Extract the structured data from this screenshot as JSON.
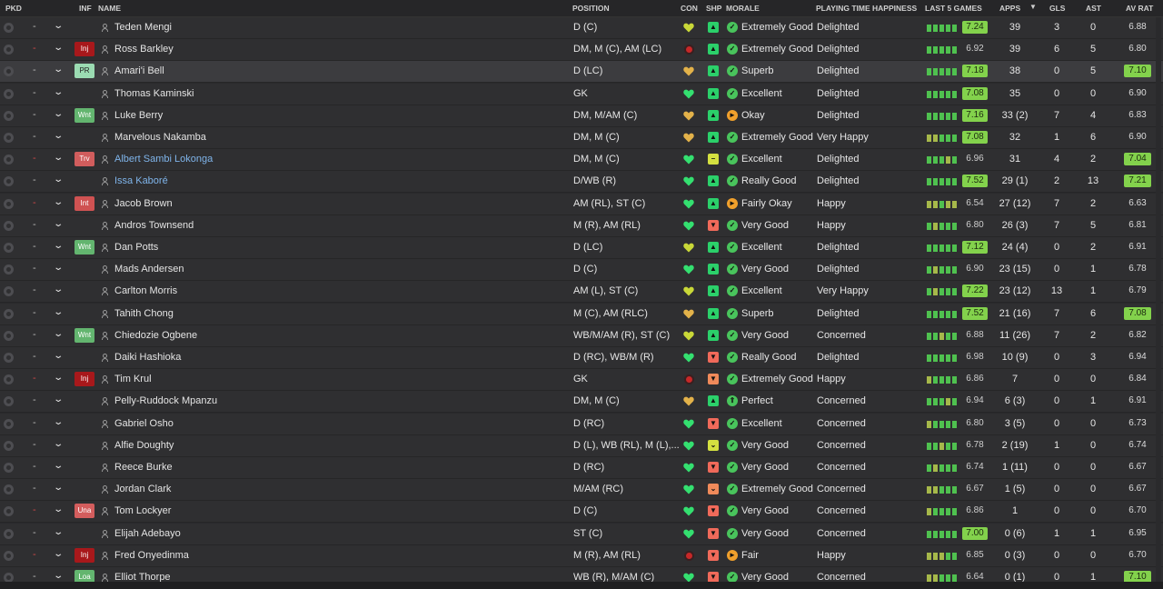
{
  "headers": {
    "pkd": "PKD",
    "inf": "INF",
    "name": "NAME",
    "position": "POSITION",
    "con": "CON",
    "shp": "SHP",
    "morale": "MORALE",
    "playing_time": "PLAYING TIME HAPPINESS",
    "last5": "LAST 5 GAMES",
    "apps": "APPS",
    "sort_icon": "sort-desc-icon",
    "gls": "GLS",
    "ast": "AST",
    "av_rat": "AV RAT"
  },
  "colors": {
    "form_green": "#4fc14f",
    "form_olive": "#a6b84a",
    "form_orange": "#d48a3e",
    "rating_highlight": "#83d24c",
    "injury_red": "#a8181b",
    "link_blue": "#7fb4ea"
  },
  "players": [
    {
      "dash": "-",
      "inf": "",
      "name": "Teden Mengi",
      "position": "D (C)",
      "con": "yellow",
      "shp": "g",
      "shp_icon": "arrow-up-icon",
      "mor": "g",
      "mor_icon": "thumbs-up-icon",
      "morale": "Extremely Good",
      "pt": "Delighted",
      "form": [
        "g",
        "g",
        "g",
        "g",
        "g"
      ],
      "l5": "7.24",
      "l5_hi": true,
      "apps": "39",
      "gls": "3",
      "ast": "0",
      "avr": "6.88",
      "avr_hi": false
    },
    {
      "dash": "-",
      "inf": "Inj",
      "inf_class": "inj",
      "name": "Ross Barkley",
      "position": "DM, M (C), AM (LC)",
      "con": "injured",
      "shp": "g",
      "shp_icon": "arrow-up-icon",
      "mor": "g",
      "mor_icon": "thumbs-up-icon",
      "morale": "Extremely Good",
      "pt": "Delighted",
      "form": [
        "g",
        "g",
        "g",
        "g",
        "g"
      ],
      "l5": "6.92",
      "l5_hi": false,
      "apps": "39",
      "gls": "6",
      "ast": "5",
      "avr": "6.80",
      "avr_hi": false
    },
    {
      "dash": "-",
      "inf": "PR",
      "inf_class": "pr",
      "name": "Amari'i Bell",
      "position": "D (LC)",
      "con": "orange",
      "shp": "g",
      "shp_icon": "arrow-up-icon",
      "mor": "g",
      "mor_icon": "thumbs-up-icon",
      "morale": "Superb",
      "pt": "Delighted",
      "form": [
        "g",
        "g",
        "g",
        "g",
        "g"
      ],
      "l5": "7.18",
      "l5_hi": true,
      "apps": "38",
      "gls": "0",
      "ast": "5",
      "avr": "7.10",
      "avr_hi": true,
      "selected": true
    },
    {
      "dash": "-",
      "inf": "",
      "name": "Thomas Kaminski",
      "position": "GK",
      "con": "green",
      "shp": "g",
      "shp_icon": "arrow-up-icon",
      "mor": "g",
      "mor_icon": "thumbs-up-icon",
      "morale": "Excellent",
      "pt": "Delighted",
      "form": [
        "g",
        "g",
        "g",
        "g",
        "g"
      ],
      "l5": "7.08",
      "l5_hi": true,
      "apps": "35",
      "gls": "0",
      "ast": "0",
      "avr": "6.90",
      "avr_hi": false
    },
    {
      "dash": "-",
      "inf": "Wnt",
      "inf_class": "wnt",
      "name": "Luke Berry",
      "position": "DM, M/AM (C)",
      "con": "orange",
      "shp": "g",
      "shp_icon": "arrow-up-icon",
      "mor": "o",
      "mor_icon": "arrow-right-icon",
      "morale": "Okay",
      "pt": "Delighted",
      "form": [
        "g",
        "g",
        "g",
        "g",
        "g"
      ],
      "l5": "7.16",
      "l5_hi": true,
      "apps": "33 (2)",
      "gls": "7",
      "ast": "4",
      "avr": "6.83",
      "avr_hi": false
    },
    {
      "dash": "-",
      "inf": "",
      "name": "Marvelous Nakamba",
      "position": "DM, M (C)",
      "con": "orange",
      "shp": "g",
      "shp_icon": "arrow-up-icon",
      "mor": "g",
      "mor_icon": "thumbs-up-icon",
      "morale": "Extremely Good",
      "pt": "Very Happy",
      "form": [
        "o",
        "o",
        "g",
        "g",
        "g"
      ],
      "l5": "7.08",
      "l5_hi": true,
      "apps": "32",
      "gls": "1",
      "ast": "6",
      "avr": "6.90",
      "avr_hi": false
    },
    {
      "dash": "-",
      "inf": "Trv",
      "inf_class": "trv",
      "name": "Albert Sambi Lokonga",
      "name_link": true,
      "position": "DM, M (C)",
      "con": "green",
      "shp": "y",
      "shp_icon": "minus-icon",
      "mor": "g",
      "mor_icon": "thumbs-up-icon",
      "morale": "Excellent",
      "pt": "Delighted",
      "form": [
        "g",
        "g",
        "g",
        "o",
        "g"
      ],
      "l5": "6.96",
      "l5_hi": false,
      "apps": "31",
      "gls": "4",
      "ast": "2",
      "avr": "7.04",
      "avr_hi": true
    },
    {
      "dash": "-",
      "inf": "",
      "name": "Issa Kaboré",
      "name_link": true,
      "position": "D/WB (R)",
      "con": "green",
      "shp": "g",
      "shp_icon": "arrow-up-icon",
      "mor": "g",
      "mor_icon": "thumbs-up-icon",
      "morale": "Really Good",
      "pt": "Delighted",
      "form": [
        "g",
        "g",
        "g",
        "g",
        "g"
      ],
      "l5": "7.52",
      "l5_hi": true,
      "apps": "29 (1)",
      "gls": "2",
      "ast": "13",
      "avr": "7.21",
      "avr_hi": true
    },
    {
      "dash": "-",
      "inf": "Int",
      "inf_class": "int",
      "name": "Jacob Brown",
      "position": "AM (RL), ST (C)",
      "con": "green",
      "shp": "g",
      "shp_icon": "arrow-up-icon",
      "mor": "o",
      "mor_icon": "arrow-right-icon",
      "morale": "Fairly Okay",
      "pt": "Happy",
      "form": [
        "o",
        "o",
        "g",
        "o",
        "o"
      ],
      "l5": "6.54",
      "l5_hi": false,
      "apps": "27 (12)",
      "gls": "7",
      "ast": "2",
      "avr": "6.63",
      "avr_hi": false
    },
    {
      "dash": "-",
      "inf": "",
      "name": "Andros Townsend",
      "position": "M (R), AM (RL)",
      "con": "green",
      "shp": "r",
      "shp_icon": "arrow-down-icon",
      "mor": "g",
      "mor_icon": "thumbs-up-icon",
      "morale": "Very Good",
      "pt": "Happy",
      "form": [
        "g",
        "o",
        "g",
        "g",
        "g"
      ],
      "l5": "6.80",
      "l5_hi": false,
      "apps": "26 (3)",
      "gls": "7",
      "ast": "5",
      "avr": "6.81",
      "avr_hi": false
    },
    {
      "dash": "-",
      "inf": "Wnt",
      "inf_class": "wnt",
      "name": "Dan Potts",
      "position": "D (LC)",
      "con": "yellow",
      "shp": "g",
      "shp_icon": "arrow-up-icon",
      "mor": "g",
      "mor_icon": "thumbs-up-icon",
      "morale": "Excellent",
      "pt": "Delighted",
      "form": [
        "g",
        "g",
        "g",
        "g",
        "g"
      ],
      "l5": "7.12",
      "l5_hi": true,
      "apps": "24 (4)",
      "gls": "0",
      "ast": "2",
      "avr": "6.91",
      "avr_hi": false
    },
    {
      "dash": "-",
      "inf": "",
      "name": "Mads Andersen",
      "position": "D (C)",
      "con": "green",
      "shp": "g",
      "shp_icon": "arrow-up-icon",
      "mor": "g",
      "mor_icon": "thumbs-up-icon",
      "morale": "Very Good",
      "pt": "Delighted",
      "form": [
        "g",
        "o",
        "g",
        "g",
        "g"
      ],
      "l5": "6.90",
      "l5_hi": false,
      "apps": "23 (15)",
      "gls": "0",
      "ast": "1",
      "avr": "6.78",
      "avr_hi": false
    },
    {
      "dash": "-",
      "inf": "",
      "name": "Carlton Morris",
      "position": "AM (L), ST (C)",
      "con": "yellow",
      "shp": "g",
      "shp_icon": "arrow-up-icon",
      "mor": "g",
      "mor_icon": "thumbs-up-icon",
      "morale": "Excellent",
      "pt": "Very Happy",
      "form": [
        "g",
        "o",
        "g",
        "g",
        "g"
      ],
      "l5": "7.22",
      "l5_hi": true,
      "apps": "23 (12)",
      "gls": "13",
      "ast": "1",
      "avr": "6.79",
      "avr_hi": false
    },
    {
      "dash": "-",
      "inf": "",
      "name": "Tahith Chong",
      "position": "M (C), AM (RLC)",
      "con": "orange",
      "shp": "g",
      "shp_icon": "arrow-up-icon",
      "mor": "g",
      "mor_icon": "thumbs-up-icon",
      "morale": "Superb",
      "pt": "Delighted",
      "form": [
        "g",
        "g",
        "g",
        "g",
        "g"
      ],
      "l5": "7.52",
      "l5_hi": true,
      "apps": "21 (16)",
      "gls": "7",
      "ast": "6",
      "avr": "7.08",
      "avr_hi": true
    },
    {
      "dash": "-",
      "inf": "Wnt",
      "inf_class": "wnt",
      "name": "Chiedozie Ogbene",
      "position": "WB/M/AM (R), ST (C)",
      "con": "yellow",
      "shp": "g",
      "shp_icon": "arrow-up-icon",
      "mor": "g",
      "mor_icon": "thumbs-up-icon",
      "morale": "Very Good",
      "pt": "Concerned",
      "form": [
        "g",
        "g",
        "o",
        "g",
        "g"
      ],
      "l5": "6.88",
      "l5_hi": false,
      "apps": "11 (26)",
      "gls": "7",
      "ast": "2",
      "avr": "6.82",
      "avr_hi": false
    },
    {
      "dash": "-",
      "inf": "",
      "name": "Daiki Hashioka",
      "position": "D (RC), WB/M (R)",
      "con": "green",
      "shp": "r",
      "shp_icon": "arrow-down-icon",
      "mor": "g",
      "mor_icon": "thumbs-up-icon",
      "morale": "Really Good",
      "pt": "Delighted",
      "form": [
        "g",
        "g",
        "g",
        "g",
        "g"
      ],
      "l5": "6.98",
      "l5_hi": false,
      "apps": "10 (9)",
      "gls": "0",
      "ast": "3",
      "avr": "6.94",
      "avr_hi": false
    },
    {
      "dash": "-",
      "inf": "Inj",
      "inf_class": "inj",
      "name": "Tim Krul",
      "position": "GK",
      "con": "injured",
      "shp": "o",
      "shp_icon": "arrow-down-icon",
      "mor": "g",
      "mor_icon": "thumbs-up-icon",
      "morale": "Extremely Good",
      "pt": "Happy",
      "form": [
        "o",
        "g",
        "g",
        "g",
        "g"
      ],
      "l5": "6.86",
      "l5_hi": false,
      "apps": "7",
      "gls": "0",
      "ast": "0",
      "avr": "6.84",
      "avr_hi": false
    },
    {
      "dash": "-",
      "inf": "",
      "name": "Pelly-Ruddock Mpanzu",
      "position": "DM, M (C)",
      "con": "orange",
      "shp": "g",
      "shp_icon": "arrow-up-icon",
      "mor": "g",
      "mor_icon": "double-up-icon",
      "morale": "Perfect",
      "pt": "Concerned",
      "form": [
        "g",
        "g",
        "g",
        "o",
        "g"
      ],
      "l5": "6.94",
      "l5_hi": false,
      "apps": "6 (3)",
      "gls": "0",
      "ast": "1",
      "avr": "6.91",
      "avr_hi": false
    },
    {
      "dash": "-",
      "inf": "",
      "name": "Gabriel Osho",
      "position": "D (RC)",
      "con": "green",
      "shp": "r",
      "shp_icon": "arrow-down-icon",
      "mor": "g",
      "mor_icon": "thumbs-up-icon",
      "morale": "Excellent",
      "pt": "Concerned",
      "form": [
        "o",
        "g",
        "g",
        "g",
        "g"
      ],
      "l5": "6.80",
      "l5_hi": false,
      "apps": "3 (5)",
      "gls": "0",
      "ast": "0",
      "avr": "6.73",
      "avr_hi": false
    },
    {
      "dash": "-",
      "inf": "",
      "name": "Alfie Doughty",
      "position": "D (L), WB (RL), M (L),...",
      "con": "green",
      "shp": "y",
      "shp_icon": "chevron-down-icon",
      "mor": "g",
      "mor_icon": "thumbs-up-icon",
      "morale": "Very Good",
      "pt": "Concerned",
      "form": [
        "g",
        "g",
        "o",
        "g",
        "g"
      ],
      "l5": "6.78",
      "l5_hi": false,
      "apps": "2 (19)",
      "gls": "1",
      "ast": "0",
      "avr": "6.74",
      "avr_hi": false
    },
    {
      "dash": "-",
      "inf": "",
      "name": "Reece Burke",
      "position": "D (RC)",
      "con": "green",
      "shp": "r",
      "shp_icon": "arrow-down-icon",
      "mor": "g",
      "mor_icon": "thumbs-up-icon",
      "morale": "Very Good",
      "pt": "Concerned",
      "form": [
        "g",
        "o",
        "g",
        "g",
        "g"
      ],
      "l5": "6.74",
      "l5_hi": false,
      "apps": "1 (11)",
      "gls": "0",
      "ast": "0",
      "avr": "6.67",
      "avr_hi": false
    },
    {
      "dash": "-",
      "inf": "",
      "name": "Jordan Clark",
      "position": "M/AM (RC)",
      "con": "green",
      "shp": "o",
      "shp_icon": "chevron-down-icon",
      "mor": "g",
      "mor_icon": "thumbs-up-icon",
      "morale": "Extremely Good",
      "pt": "Concerned",
      "form": [
        "o",
        "o",
        "g",
        "g",
        "g"
      ],
      "l5": "6.67",
      "l5_hi": false,
      "apps": "1 (5)",
      "gls": "0",
      "ast": "0",
      "avr": "6.67",
      "avr_hi": false
    },
    {
      "dash": "-",
      "inf": "Una",
      "inf_class": "una",
      "name": "Tom Lockyer",
      "position": "D (C)",
      "con": "green",
      "shp": "r",
      "shp_icon": "arrow-down-icon",
      "mor": "g",
      "mor_icon": "thumbs-up-icon",
      "morale": "Very Good",
      "pt": "Concerned",
      "form": [
        "o",
        "g",
        "g",
        "g",
        "g"
      ],
      "l5": "6.86",
      "l5_hi": false,
      "apps": "1",
      "gls": "0",
      "ast": "0",
      "avr": "6.70",
      "avr_hi": false
    },
    {
      "dash": "-",
      "inf": "",
      "name": "Elijah Adebayo",
      "position": "ST (C)",
      "con": "green",
      "shp": "r",
      "shp_icon": "arrow-down-icon",
      "mor": "g",
      "mor_icon": "thumbs-up-icon",
      "morale": "Very Good",
      "pt": "Concerned",
      "form": [
        "g",
        "g",
        "g",
        "g",
        "g"
      ],
      "l5": "7.00",
      "l5_hi": true,
      "apps": "0 (6)",
      "gls": "1",
      "ast": "1",
      "avr": "6.95",
      "avr_hi": false
    },
    {
      "dash": "-",
      "inf": "Inj",
      "inf_class": "inj",
      "name": "Fred Onyedinma",
      "position": "M (R), AM (RL)",
      "con": "injured",
      "shp": "r",
      "shp_icon": "arrow-down-icon",
      "mor": "o",
      "mor_icon": "arrow-right-icon",
      "morale": "Fair",
      "pt": "Happy",
      "form": [
        "o",
        "o",
        "o",
        "g",
        "g"
      ],
      "l5": "6.85",
      "l5_hi": false,
      "apps": "0 (3)",
      "gls": "0",
      "ast": "0",
      "avr": "6.70",
      "avr_hi": false
    },
    {
      "dash": "-",
      "inf": "Loa",
      "inf_class": "loa",
      "name": "Elliot Thorpe",
      "position": "WB (R), M/AM (C)",
      "con": "green",
      "shp": "r",
      "shp_icon": "arrow-down-icon",
      "mor": "g",
      "mor_icon": "thumbs-up-icon",
      "morale": "Very Good",
      "pt": "Concerned",
      "form": [
        "o",
        "o",
        "g",
        "g",
        "g"
      ],
      "l5": "6.64",
      "l5_hi": false,
      "apps": "0 (1)",
      "gls": "0",
      "ast": "1",
      "avr": "7.10",
      "avr_hi": true
    }
  ]
}
